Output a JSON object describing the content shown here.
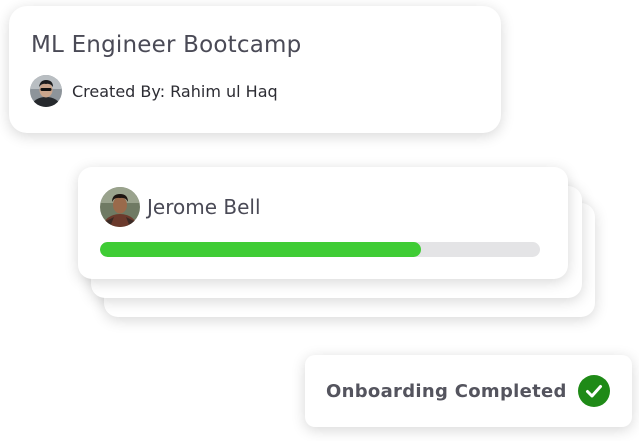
{
  "course": {
    "title": "ML Engineer Bootcamp",
    "created_by_label": "Created By: Rahim ul Haq",
    "creator_avatar_icon": "user-avatar-photo"
  },
  "learner": {
    "name": "Jerome Bell",
    "avatar_icon": "user-avatar-photo",
    "progress": 0.73,
    "progress_color": "#3fcc35",
    "track_color": "#e4e4e6"
  },
  "status": {
    "label": "Onboarding Completed",
    "icon": "check-circle-icon",
    "icon_color": "#1f8a17"
  }
}
